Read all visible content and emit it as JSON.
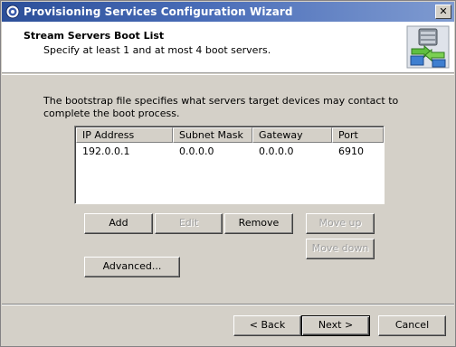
{
  "window": {
    "title": "Provisioning Services Configuration Wizard"
  },
  "header": {
    "title": "Stream Servers Boot List",
    "subtitle": "Specify at least 1 and at most 4 boot servers."
  },
  "description": "The bootstrap file specifies what servers target devices may contact to complete the boot process.",
  "server_list": {
    "columns": [
      "IP Address",
      "Subnet Mask",
      "Gateway",
      "Port"
    ],
    "rows": [
      {
        "ip": "192.0.0.1",
        "subnet": "0.0.0.0",
        "gateway": "0.0.0.0",
        "port": "6910"
      }
    ]
  },
  "buttons": {
    "add": "Add",
    "edit": "Edit",
    "remove": "Remove",
    "move_up": "Move up",
    "move_down": "Move down",
    "advanced": "Advanced...",
    "back": "< Back",
    "next": "Next >",
    "cancel": "Cancel"
  },
  "colors": {
    "titlebar_start": "#2c4f99",
    "titlebar_end": "#7f9bd1",
    "dialog_face": "#d4d0c8"
  },
  "icons": {
    "app": "citrix-provisioning-icon",
    "header": "server-sync-icon",
    "close": "close-icon"
  }
}
